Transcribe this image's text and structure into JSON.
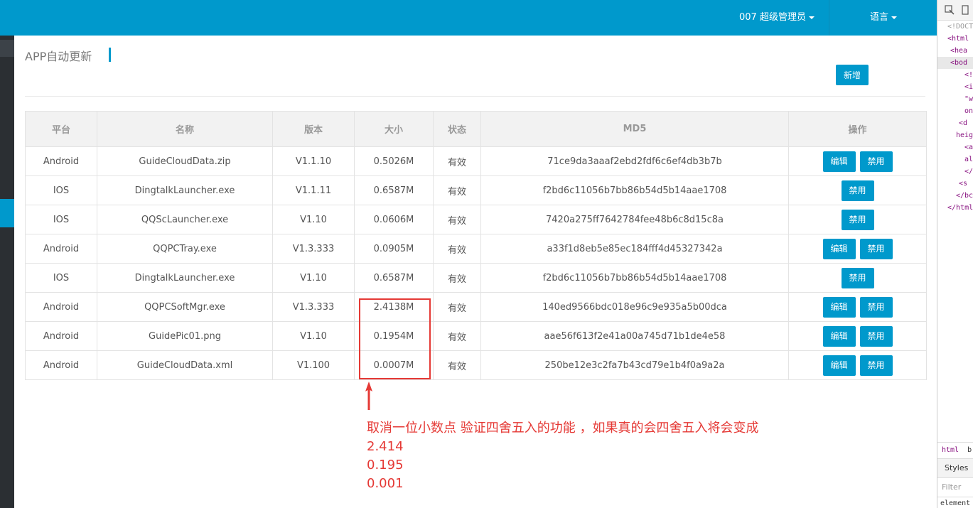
{
  "header": {
    "user_label": "007 超级管理员",
    "lang_label": "语言"
  },
  "page": {
    "title": "APP自动更新",
    "add_button": "新增"
  },
  "table": {
    "columns": [
      "平台",
      "名称",
      "版本",
      "大小",
      "状态",
      "MD5",
      "操作"
    ],
    "rows": [
      {
        "platform": "Android",
        "name": "GuideCloudData.zip",
        "version": "V1.1.10",
        "size": "0.5026M",
        "status": "有效",
        "md5": "71ce9da3aaaf2ebd2fdf6c6ef4db3b7b",
        "edit": "编辑",
        "disable": "禁用"
      },
      {
        "platform": "IOS",
        "name": "DingtalkLauncher.exe",
        "version": "V1.1.11",
        "size": "0.6587M",
        "status": "有效",
        "md5": "f2bd6c11056b7bb86b54d5b14aae1708",
        "edit": "",
        "disable": "禁用"
      },
      {
        "platform": "IOS",
        "name": "QQScLauncher.exe",
        "version": "V1.10",
        "size": "0.0606M",
        "status": "有效",
        "md5": "7420a275ff7642784fee48b6c8d15c8a",
        "edit": "",
        "disable": "禁用"
      },
      {
        "platform": "Android",
        "name": "QQPCTray.exe",
        "version": "V1.3.333",
        "size": "0.0905M",
        "status": "有效",
        "md5": "a33f1d8eb5e85ec184fff4d45327342a",
        "edit": "编辑",
        "disable": "禁用"
      },
      {
        "platform": "IOS",
        "name": "DingtalkLauncher.exe",
        "version": "V1.10",
        "size": "0.6587M",
        "status": "有效",
        "md5": "f2bd6c11056b7bb86b54d5b14aae1708",
        "edit": "",
        "disable": "禁用"
      },
      {
        "platform": "Android",
        "name": "QQPCSoftMgr.exe",
        "version": "V1.3.333",
        "size": "2.4138M",
        "status": "有效",
        "md5": "140ed9566bdc018e96c9e935a5b00dca",
        "edit": "编辑",
        "disable": "禁用"
      },
      {
        "platform": "Android",
        "name": "GuidePic01.png",
        "version": "V1.10",
        "size": "0.1954M",
        "status": "有效",
        "md5": "aae56f613f2e41a00a745d71b1de4e58",
        "edit": "编辑",
        "disable": "禁用"
      },
      {
        "platform": "Android",
        "name": "GuideCloudData.xml",
        "version": "V1.100",
        "size": "0.0007M",
        "status": "有效",
        "md5": "250be12e3c2fa7b43cd79e1b4f0a9a2a",
        "edit": "编辑",
        "disable": "禁用"
      }
    ]
  },
  "annotation": {
    "lines": [
      "取消一位小数点 验证四舍五入的功能 ，如果真的会四舍五入将会变成",
      "2.414",
      "0.195",
      "0.001"
    ],
    "color": "#e53935"
  },
  "devtools": {
    "lines": [
      "<!DOCT",
      "<html",
      "<hea",
      "<bod",
      "<!",
      "<i",
      "\"w",
      "on",
      "<d",
      "heig",
      "<a",
      "al",
      "</",
      "<s",
      "</bc",
      "</html"
    ],
    "tab_html": "html",
    "tab_b": "b",
    "styles": "Styles",
    "filter": "Filter",
    "element": "element"
  },
  "colors": {
    "brand": "#0099cc",
    "sidebar": "#2b2f33"
  }
}
